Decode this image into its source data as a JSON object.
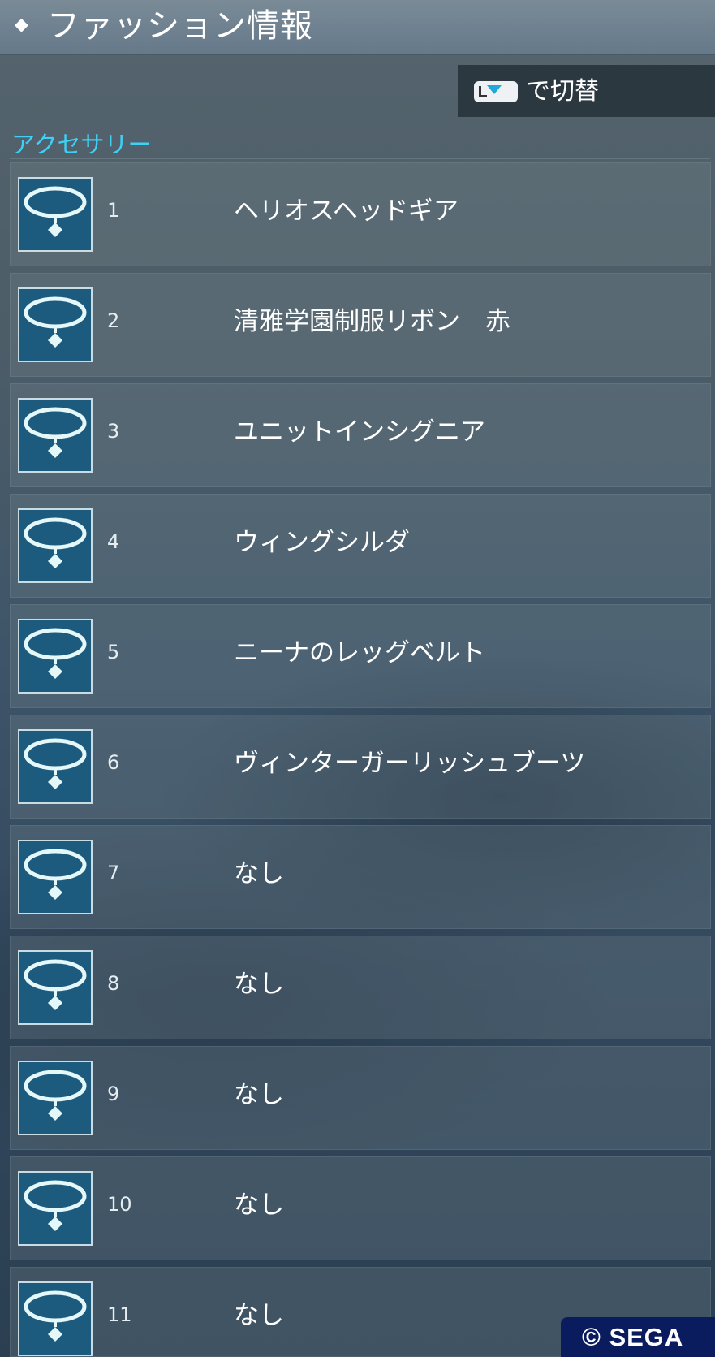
{
  "header": {
    "title": "ファッション情報"
  },
  "switch": {
    "label": "で切替",
    "icon": "touchpad-down-icon"
  },
  "section": {
    "title": "アクセサリー"
  },
  "accessories": [
    {
      "number": "1",
      "name": "ヘリオスヘッドギア",
      "icon": "accessory-necklace-icon"
    },
    {
      "number": "2",
      "name": "清雅学園制服リボン　赤",
      "icon": "accessory-necklace-icon"
    },
    {
      "number": "3",
      "name": "ユニットインシグニア",
      "icon": "accessory-necklace-icon"
    },
    {
      "number": "4",
      "name": "ウィングシルダ",
      "icon": "accessory-necklace-icon"
    },
    {
      "number": "5",
      "name": "ニーナのレッグベルト",
      "icon": "accessory-necklace-icon"
    },
    {
      "number": "6",
      "name": "ヴィンターガーリッシュブーツ",
      "icon": "accessory-necklace-icon"
    },
    {
      "number": "7",
      "name": "なし",
      "icon": "accessory-necklace-icon"
    },
    {
      "number": "8",
      "name": "なし",
      "icon": "accessory-necklace-icon"
    },
    {
      "number": "9",
      "name": "なし",
      "icon": "accessory-necklace-icon"
    },
    {
      "number": "10",
      "name": "なし",
      "icon": "accessory-necklace-icon"
    },
    {
      "number": "11",
      "name": "なし",
      "icon": "accessory-necklace-icon"
    }
  ],
  "copyright": "© SEGA",
  "colors": {
    "section_title": "#3fd0f5",
    "icon_background": "#1c5a7e",
    "copyright_background": "#0b1c5e"
  }
}
